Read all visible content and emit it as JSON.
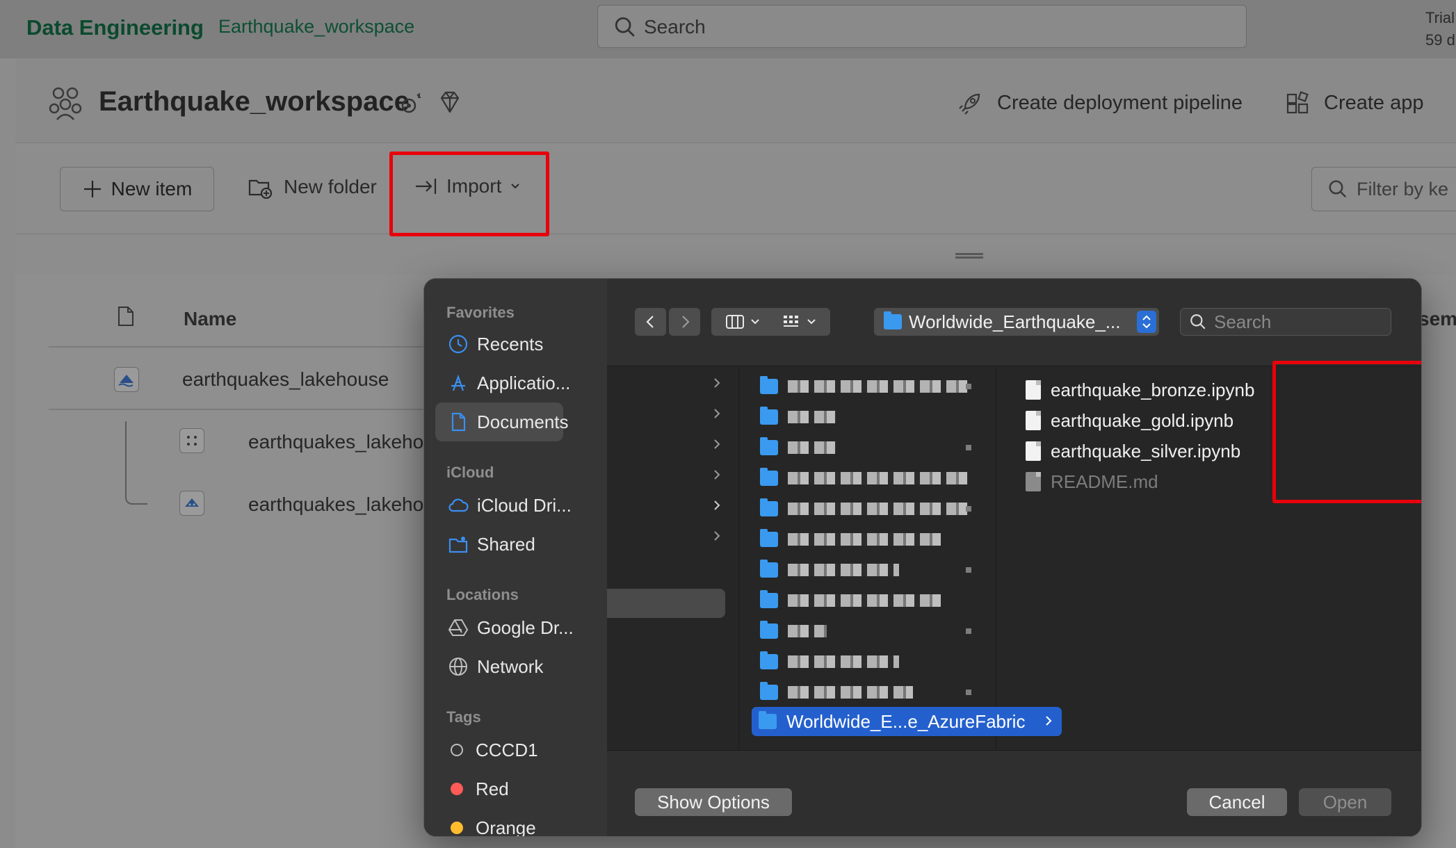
{
  "topbar": {
    "brand": "Data Engineering",
    "workspace_link": "Earthquake_workspace",
    "search_placeholder": "Search",
    "trial_text": "Trial\n59 d"
  },
  "workspace": {
    "title": "Earthquake_workspace",
    "deploy_label": "Create deployment pipeline",
    "app_label": "Create app"
  },
  "toolbar": {
    "new_item": "New item",
    "new_folder": "New folder",
    "import": "Import",
    "filter_placeholder": "Filter by ke"
  },
  "list": {
    "name_header": "Name",
    "sem_header": "sem",
    "rows": [
      {
        "name": "earthquakes_lakehouse"
      },
      {
        "name": "earthquakes_lakehou"
      },
      {
        "name": "earthquakes_lakehou"
      }
    ]
  },
  "dialog": {
    "sidebar": {
      "favorites_head": "Favorites",
      "favorites": [
        "Recents",
        "Applicatio...",
        "Documents"
      ],
      "icloud_head": "iCloud",
      "icloud": [
        "iCloud Dri...",
        "Shared"
      ],
      "locations_head": "Locations",
      "locations": [
        "Google Dr...",
        "Network"
      ],
      "tags_head": "Tags",
      "tags": [
        {
          "label": "CCCD1",
          "color": "transparent"
        },
        {
          "label": "Red",
          "color": "#ff5b57"
        },
        {
          "label": "Orange",
          "color": "#ffbd2e"
        }
      ]
    },
    "path_label": "Worldwide_Earthquake_...",
    "search_placeholder": "Search",
    "selected_folder": "Worldwide_E...e_AzureFabric",
    "files": [
      {
        "name": "earthquake_bronze.ipynb",
        "enabled": true
      },
      {
        "name": "earthquake_gold.ipynb",
        "enabled": true
      },
      {
        "name": "earthquake_silver.ipynb",
        "enabled": true
      },
      {
        "name": "README.md",
        "enabled": false
      }
    ],
    "show_options": "Show Options",
    "cancel": "Cancel",
    "open": "Open"
  },
  "colors": {
    "highlight_box": "#e8000b",
    "selection_blue": "#2460cd",
    "folder_blue": "#3a9af0"
  }
}
